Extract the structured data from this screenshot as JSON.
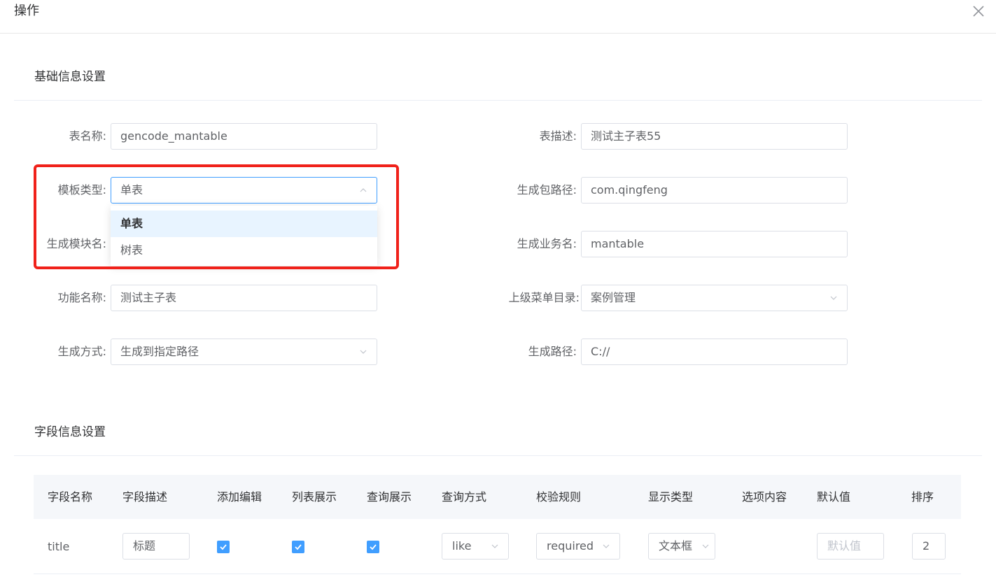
{
  "dialog": {
    "title": "操作",
    "close_icon": "close-icon"
  },
  "basic": {
    "section_title": "基础信息设置",
    "fields": {
      "table_name": {
        "label": "表名称:",
        "value": "gencode_mantable"
      },
      "table_desc": {
        "label": "表描述:",
        "value": "测试主子表55"
      },
      "template_type": {
        "label": "模板类型:",
        "value": "单表",
        "options": [
          "单表",
          "树表"
        ]
      },
      "package_path": {
        "label": "生成包路径:",
        "value": "com.qingfeng"
      },
      "module_name": {
        "label": "生成模块名:",
        "value": ""
      },
      "business_name": {
        "label": "生成业务名:",
        "value": "mantable"
      },
      "function_name": {
        "label": "功能名称:",
        "value": "测试主子表"
      },
      "parent_menu": {
        "label": "上级菜单目录:",
        "value": "案例管理"
      },
      "gen_method": {
        "label": "生成方式:",
        "value": "生成到指定路径"
      },
      "gen_path": {
        "label": "生成路径:",
        "value": "C://"
      }
    }
  },
  "fields_section": {
    "section_title": "字段信息设置",
    "columns": [
      "字段名称",
      "字段描述",
      "添加编辑",
      "列表展示",
      "查询展示",
      "查询方式",
      "校验规则",
      "显示类型",
      "选项内容",
      "默认值",
      "排序"
    ],
    "rows": [
      {
        "name": "title",
        "desc": "标题",
        "add_edit": true,
        "list_show": true,
        "query_show": true,
        "query_method": "like",
        "validate": "required",
        "display_type": "文本框",
        "options": "",
        "default_placeholder": "默认值",
        "sort": "2"
      }
    ]
  },
  "colors": {
    "primary": "#409eff",
    "highlight": "#f0211a"
  }
}
